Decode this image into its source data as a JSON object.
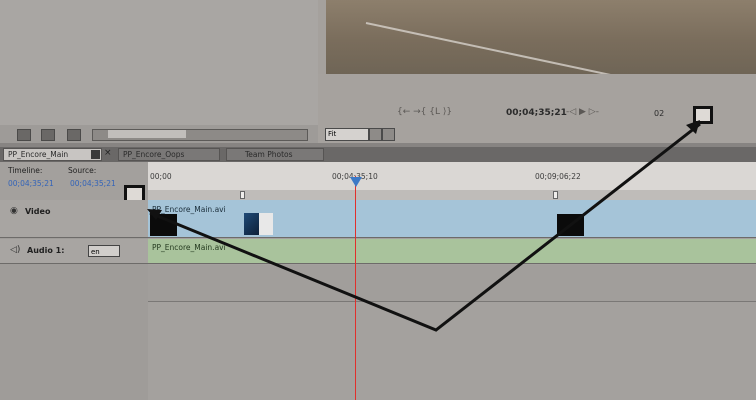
{
  "monitor": {
    "timecode": "00;04;35;21",
    "page_label": "02",
    "fit_label": "Fit",
    "transport_left": "{← →{ {L ⟩}",
    "transport_mid": "-◁   ▶   ▷-"
  },
  "tabs": [
    {
      "label": "PP_Encore_Main"
    },
    {
      "label": "PP_Encore_Oops"
    },
    {
      "label": "Team Photos"
    }
  ],
  "timeline": {
    "timeline_label": "Timeline:",
    "source_label": "Source:",
    "timeline_tc": "00;04;35;21",
    "source_tc": "00;04;35;21",
    "ruler_ticks": [
      "00;00",
      "00;04;35;10",
      "00;09;06;22"
    ]
  },
  "tracks": {
    "video_name": "Video",
    "video_clip": "PP_Encore_Main.avi",
    "audio_name": "Audio 1:",
    "audio_clip": "PP_Encore_Main.avi",
    "language": "en"
  }
}
